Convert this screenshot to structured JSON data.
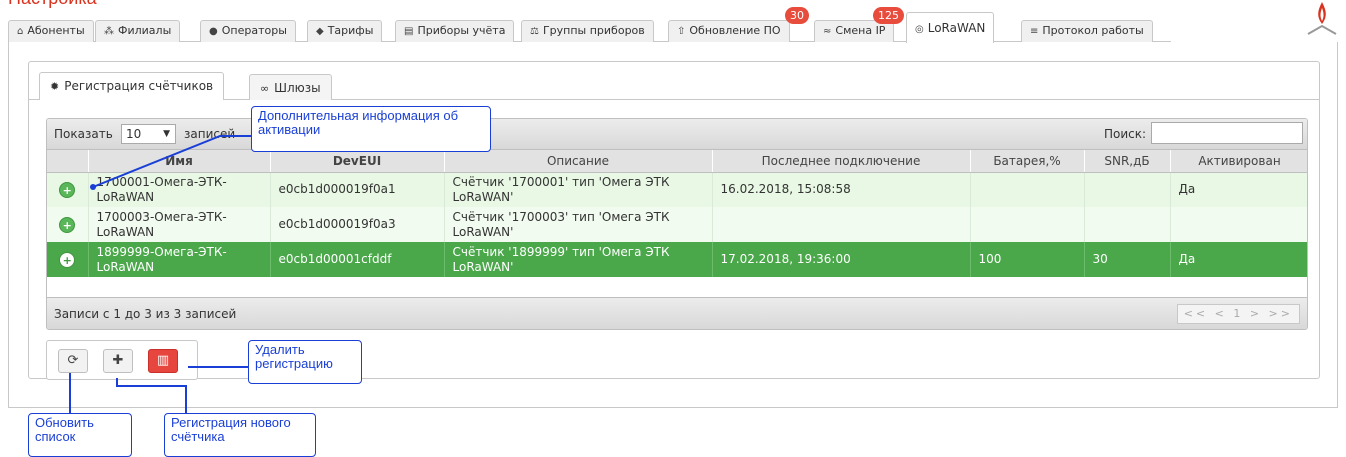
{
  "page": {
    "title": "Настройка"
  },
  "top_tabs": [
    {
      "icon": "home-icon",
      "glyph": "⌂",
      "label": "Абоненты"
    },
    {
      "icon": "sitemap-icon",
      "glyph": "⁂",
      "label": "Филиалы"
    },
    {
      "icon": "user-icon",
      "glyph": "●",
      "label": "Операторы"
    },
    {
      "icon": "tag-icon",
      "glyph": "◆",
      "label": "Тарифы"
    },
    {
      "icon": "print-icon",
      "glyph": "▤",
      "label": "Приборы учёта"
    },
    {
      "icon": "balance-icon",
      "glyph": "⚖",
      "label": "Группы приборов"
    },
    {
      "icon": "upload-icon",
      "glyph": "⇧",
      "label": "Обновление ПО",
      "badge": "30"
    },
    {
      "icon": "rss-icon",
      "glyph": "≈",
      "label": "Смена IP",
      "badge": "125"
    },
    {
      "icon": "antenna-icon",
      "glyph": "◎",
      "label": "LoRaWAN",
      "active": true
    },
    {
      "icon": "list-icon",
      "glyph": "≡",
      "label": "Протокол работы"
    }
  ],
  "sub_tabs": [
    {
      "icon": "gear-icon",
      "glyph": "✹",
      "label": "Регистрация счётчиков",
      "active": true
    },
    {
      "icon": "link-icon",
      "glyph": "∞",
      "label": "Шлюзы"
    }
  ],
  "table": {
    "show_label": "Показать",
    "page_size": "10",
    "show_suffix": "записей",
    "search_label": "Поиск:",
    "search_value": "",
    "columns": [
      "",
      "Имя",
      "DevEUI",
      "Описание",
      "Последнее подключение",
      "Батарея,%",
      "SNR,дБ",
      "Активирован"
    ],
    "rows": [
      {
        "name": "1700001-Омега-ЭТК-LoRaWAN",
        "deveui": "e0cb1d000019f0a1",
        "desc": "Счётчик '1700001' тип 'Омега ЭТК LoRaWAN'",
        "last": "16.02.2018, 15:08:58",
        "battery": "",
        "snr": "",
        "active": "Да"
      },
      {
        "name": "1700003-Омега-ЭТК-LoRaWAN",
        "deveui": "e0cb1d000019f0a3",
        "desc": "Счётчик '1700003' тип 'Омега ЭТК LoRaWAN'",
        "last": "",
        "battery": "",
        "snr": "",
        "active": ""
      },
      {
        "name": "1899999-Омега-ЭТК-LoRaWAN",
        "deveui": "e0cb1d00001cfddf",
        "desc": "Счётчик '1899999' тип 'Омега ЭТК LoRaWAN'",
        "last": "17.02.2018, 19:36:00",
        "battery": "100",
        "snr": "30",
        "active": "Да"
      }
    ],
    "footer_info": "Записи с 1 до 3 из 3 записей",
    "pager": "<< < 1 > >>"
  },
  "buttons": {
    "refresh_icon": "refresh-icon",
    "add_icon": "plus-icon",
    "delete_icon": "trash-icon"
  },
  "annotations": {
    "activation_info": "Дополнительная информация об активации",
    "delete_registration": "Удалить регистрацию",
    "refresh_list": "Обновить список",
    "new_registration": "Регистрация нового счётчика"
  },
  "colors": {
    "selected_row": "#4aa74a",
    "light_row": "#e8f8e4",
    "badge": "#e74c3c",
    "annotation": "#1a3fd6",
    "danger_button": "#e7463e"
  }
}
